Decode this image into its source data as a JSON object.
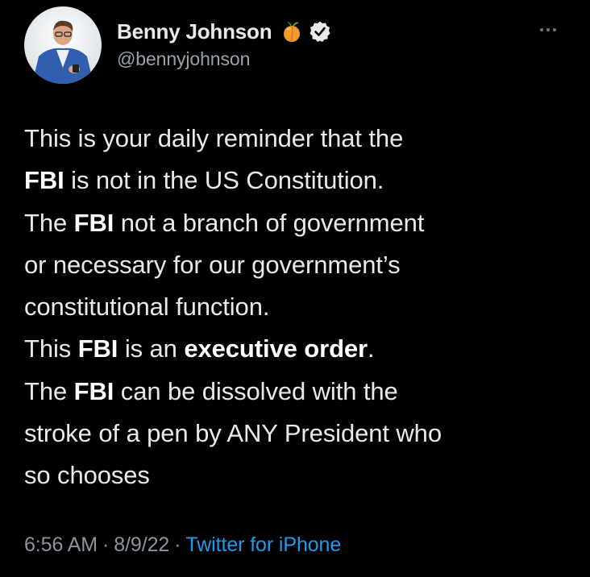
{
  "author": {
    "display_name": "Benny Johnson",
    "handle": "@bennyjohnson",
    "emoji_icon": "peach-emoji-icon",
    "verified_icon": "verified-badge-icon"
  },
  "tweet": {
    "lines": [
      [
        {
          "t": "This is your daily reminder that the",
          "b": false
        }
      ],
      [
        {
          "t": "FBI",
          "b": true
        },
        {
          "t": " is not in the US Constitution.",
          "b": false
        }
      ],
      [
        {
          "t": "The ",
          "b": false
        },
        {
          "t": "FBI",
          "b": true
        },
        {
          "t": " not a branch of government",
          "b": false
        }
      ],
      [
        {
          "t": "or necessary for our government’s",
          "b": false
        }
      ],
      [
        {
          "t": "constitutional function.",
          "b": false
        }
      ],
      [
        {
          "t": "This ",
          "b": false
        },
        {
          "t": "FBI",
          "b": true
        },
        {
          "t": " is an ",
          "b": false
        },
        {
          "t": "executive order",
          "b": true
        },
        {
          "t": ".",
          "b": false
        }
      ],
      [
        {
          "t": "The ",
          "b": false
        },
        {
          "t": "FBI",
          "b": true
        },
        {
          "t": " can be dissolved with the",
          "b": false
        }
      ],
      [
        {
          "t": "stroke of a pen by ANY President who",
          "b": false
        }
      ],
      [
        {
          "t": "so chooses",
          "b": false
        }
      ]
    ]
  },
  "meta": {
    "time": "6:56 AM",
    "separator": "·",
    "date": "8/9/22",
    "source": "Twitter for iPhone"
  },
  "colors": {
    "background": "#000000",
    "text": "#E7E9EA",
    "muted": "#8B949E",
    "link": "#1D9BF0"
  }
}
